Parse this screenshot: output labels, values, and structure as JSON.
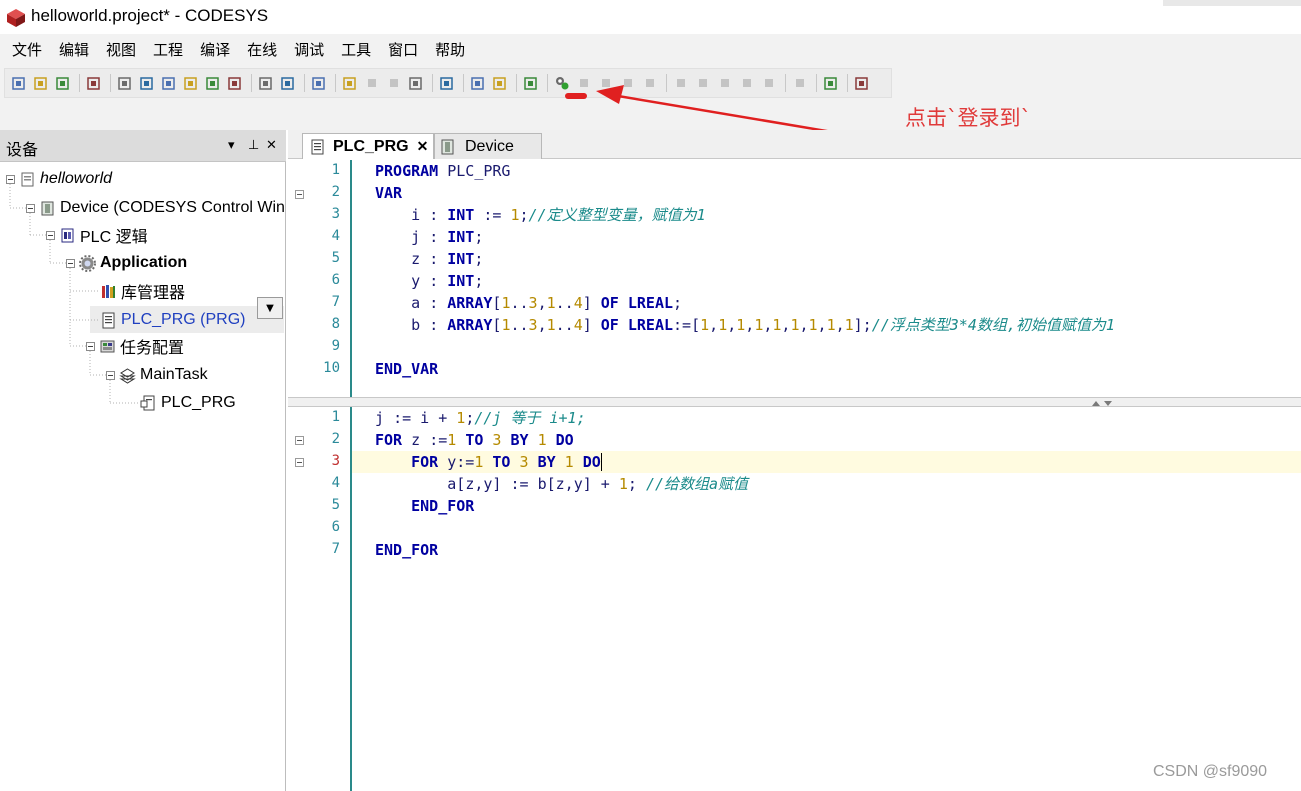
{
  "window": {
    "title": "helloworld.project* - CODESYS"
  },
  "menu": [
    "文件",
    "编辑",
    "视图",
    "工程",
    "编译",
    "在线",
    "调试",
    "工具",
    "窗口",
    "帮助"
  ],
  "toolbar": {
    "icons": [
      "new-file-icon",
      "open-folder-icon",
      "save-icon",
      "|",
      "print-icon",
      "|",
      "undo-icon",
      "redo-icon",
      "cut-icon",
      "copy-icon",
      "paste-icon",
      "delete-icon",
      "|",
      "find-icon",
      "replace-icon",
      "|",
      "rename-icon",
      "|",
      "breakpoint-icon",
      "step-icon",
      "step-over-icon",
      "clear-icon",
      "|",
      "window-icon",
      "|",
      "add-object-icon",
      "export-icon",
      "|",
      "build-icon",
      "|",
      "login-icon",
      "logout-icon",
      "run-icon",
      "stop-icon",
      "reset-icon",
      "|",
      "step-into-icon",
      "step-over2-icon",
      "step-out-icon",
      "next-icon",
      "cycle-icon",
      "|",
      "flow-icon",
      "|",
      "monitor-icon",
      "|",
      "cart-icon"
    ]
  },
  "annotation": {
    "text": "点击`登录到`",
    "color": "#e03a3a"
  },
  "devices_pane": {
    "title": "设备",
    "tree": [
      {
        "label": "helloworld",
        "icon": "project-icon",
        "italic": true
      },
      {
        "label": "Device (CODESYS Control Win",
        "icon": "device-icon"
      },
      {
        "label": "PLC 逻辑",
        "icon": "plc-logic-icon"
      },
      {
        "label": "Application",
        "icon": "application-gear-icon",
        "bold": true
      },
      {
        "label": "库管理器",
        "icon": "library-icon"
      },
      {
        "label": "PLC_PRG (PRG)",
        "icon": "program-icon",
        "selected": true
      },
      {
        "label": "任务配置",
        "icon": "task-config-icon"
      },
      {
        "label": "MainTask",
        "icon": "task-icon"
      },
      {
        "label": "PLC_PRG",
        "icon": "program-call-icon"
      }
    ]
  },
  "editor": {
    "tabs": [
      {
        "label": "PLC_PRG",
        "active": true
      },
      {
        "label": "Device",
        "active": false
      }
    ],
    "declaration_lines": [
      "1",
      "2",
      "3",
      "4",
      "5",
      "6",
      "7",
      "8",
      "9",
      "10"
    ],
    "body_lines": [
      "1",
      "2",
      "3",
      "4",
      "5",
      "6",
      "7"
    ]
  },
  "watermark": "CSDN @sf9090",
  "colors": {
    "keyword": "#0000a0",
    "comment": "#1a8a8a",
    "number": "#b58a00",
    "linenum": "#2b8a9a"
  }
}
